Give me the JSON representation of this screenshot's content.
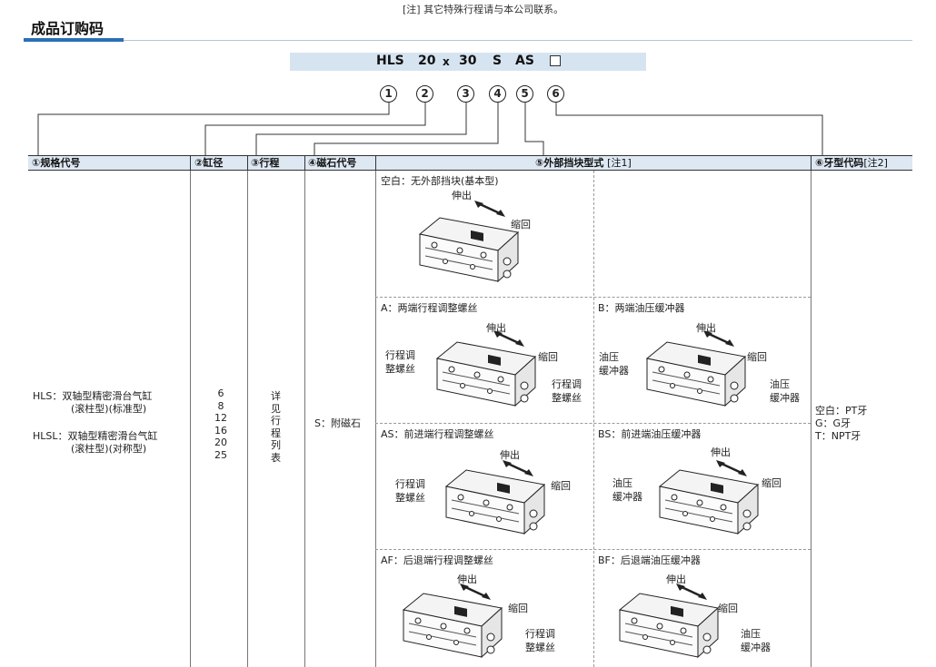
{
  "note": "[注] 其它特殊行程请与本公司联系。",
  "title": "成品订购码",
  "order_code": {
    "parts": [
      "HLS",
      "20",
      "x",
      "30",
      "S",
      "AS"
    ],
    "circles": [
      "1",
      "2",
      "3",
      "4",
      "5",
      "6"
    ]
  },
  "headers": {
    "h1": "①规格代号",
    "h2": "②缸径",
    "h3": "③行程",
    "h4": "④磁石代号",
    "h5": "⑤外部挡块型式",
    "h5_note": "[注1]",
    "h6": "⑥牙型代码",
    "h6_note": "[注2]"
  },
  "spec": {
    "hls_a": "HLS：双轴型精密滑台气缸",
    "hls_b": "(滚柱型)(标准型)",
    "hlsl_a": "HLSL：双轴型精密滑台气缸",
    "hlsl_b": "(滚柱型)(对称型)"
  },
  "bores": [
    "6",
    "8",
    "12",
    "16",
    "20",
    "25"
  ],
  "stroke": "详见行程列表",
  "magnet": "S：附磁石",
  "thread": [
    "空白：PT牙",
    "G：G牙",
    "T：NPT牙"
  ],
  "stopper": {
    "blank": "空白：无外部挡块(基本型)",
    "A": "A：两端行程调整螺丝",
    "B": "B：两端油压缓冲器",
    "AS": "AS：前进端行程调整螺丝",
    "BS": "BS：前进端油压缓冲器",
    "AF": "AF：后退端行程调整螺丝",
    "BF": "BF：后退端油压缓冲器"
  },
  "labels": {
    "extend": "伸出",
    "retract": "缩回",
    "adj1": "行程调",
    "adj2": "整螺丝",
    "sa1": "油压",
    "sa2": "缓冲器"
  }
}
